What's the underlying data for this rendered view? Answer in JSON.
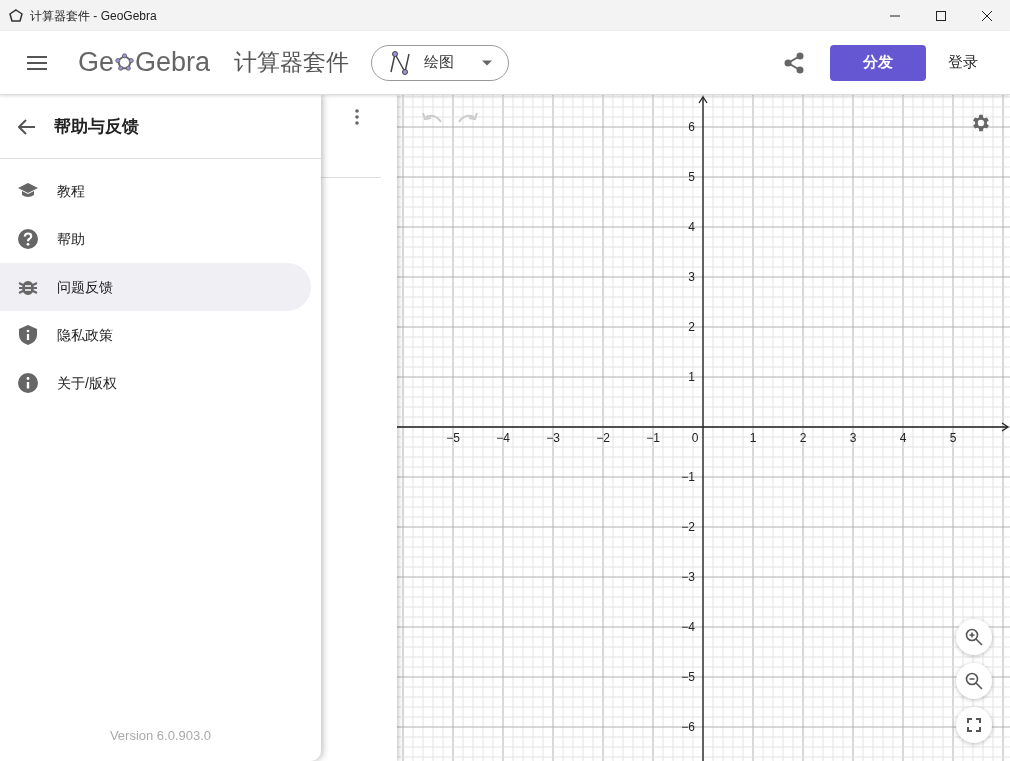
{
  "window": {
    "title": "计算器套件 - GeoGebra"
  },
  "header": {
    "logo_left": "Ge",
    "logo_right": "Gebra",
    "app_title": "计算器套件",
    "app_switcher": {
      "label": "绘图"
    },
    "share_button": "分发",
    "login_link": "登录"
  },
  "drawer": {
    "title": "帮助与反馈",
    "items": [
      {
        "label": "教程",
        "selected": false
      },
      {
        "label": "帮助",
        "selected": false
      },
      {
        "label": "问题反馈",
        "selected": true
      },
      {
        "label": "隐私政策",
        "selected": false
      },
      {
        "label": "关于/版权",
        "selected": false
      }
    ],
    "version": "Version 6.0.903.0"
  },
  "graph": {
    "x_labels": [
      "−5",
      "−4",
      "−3",
      "−2",
      "−1",
      "0",
      "1",
      "2",
      "3",
      "4",
      "5"
    ],
    "y_labels": [
      "6",
      "5",
      "4",
      "3",
      "2",
      "1",
      "−1",
      "−2",
      "−3",
      "−4",
      "−5",
      "−6"
    ]
  }
}
